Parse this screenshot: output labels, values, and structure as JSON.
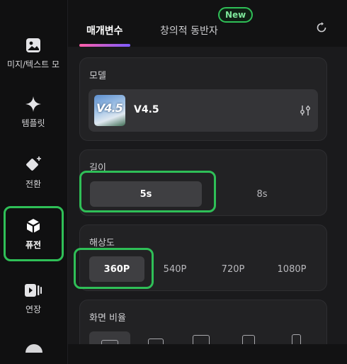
{
  "sidebar": {
    "items": [
      {
        "label": "미지/텍스트 모",
        "icon": "image-icon"
      },
      {
        "label": "템플릿",
        "icon": "sparkle-icon"
      },
      {
        "label": "전환",
        "icon": "diamond-plus-icon"
      },
      {
        "label": "퓨전",
        "icon": "cube-icon",
        "active": true
      },
      {
        "label": "연장",
        "icon": "video-extend-icon"
      }
    ]
  },
  "tabs": [
    {
      "label": "매개변수",
      "active": true
    },
    {
      "label": "창의적 동반자"
    }
  ],
  "new_badge": "New",
  "model": {
    "title": "모델",
    "name": "V4.5",
    "thumb_text": "V4.5"
  },
  "duration": {
    "title": "길이",
    "options": [
      "5s",
      "8s"
    ],
    "selected": "5s"
  },
  "resolution": {
    "title": "해상도",
    "options": [
      "360P",
      "540P",
      "720P",
      "1080P"
    ],
    "selected": "360P"
  },
  "aspect_ratio": {
    "title": "화면 비율"
  },
  "colors": {
    "highlight_green": "#2fbf57",
    "accent_gradient_start": "#ff5fa8",
    "accent_gradient_end": "#7c5cff"
  }
}
